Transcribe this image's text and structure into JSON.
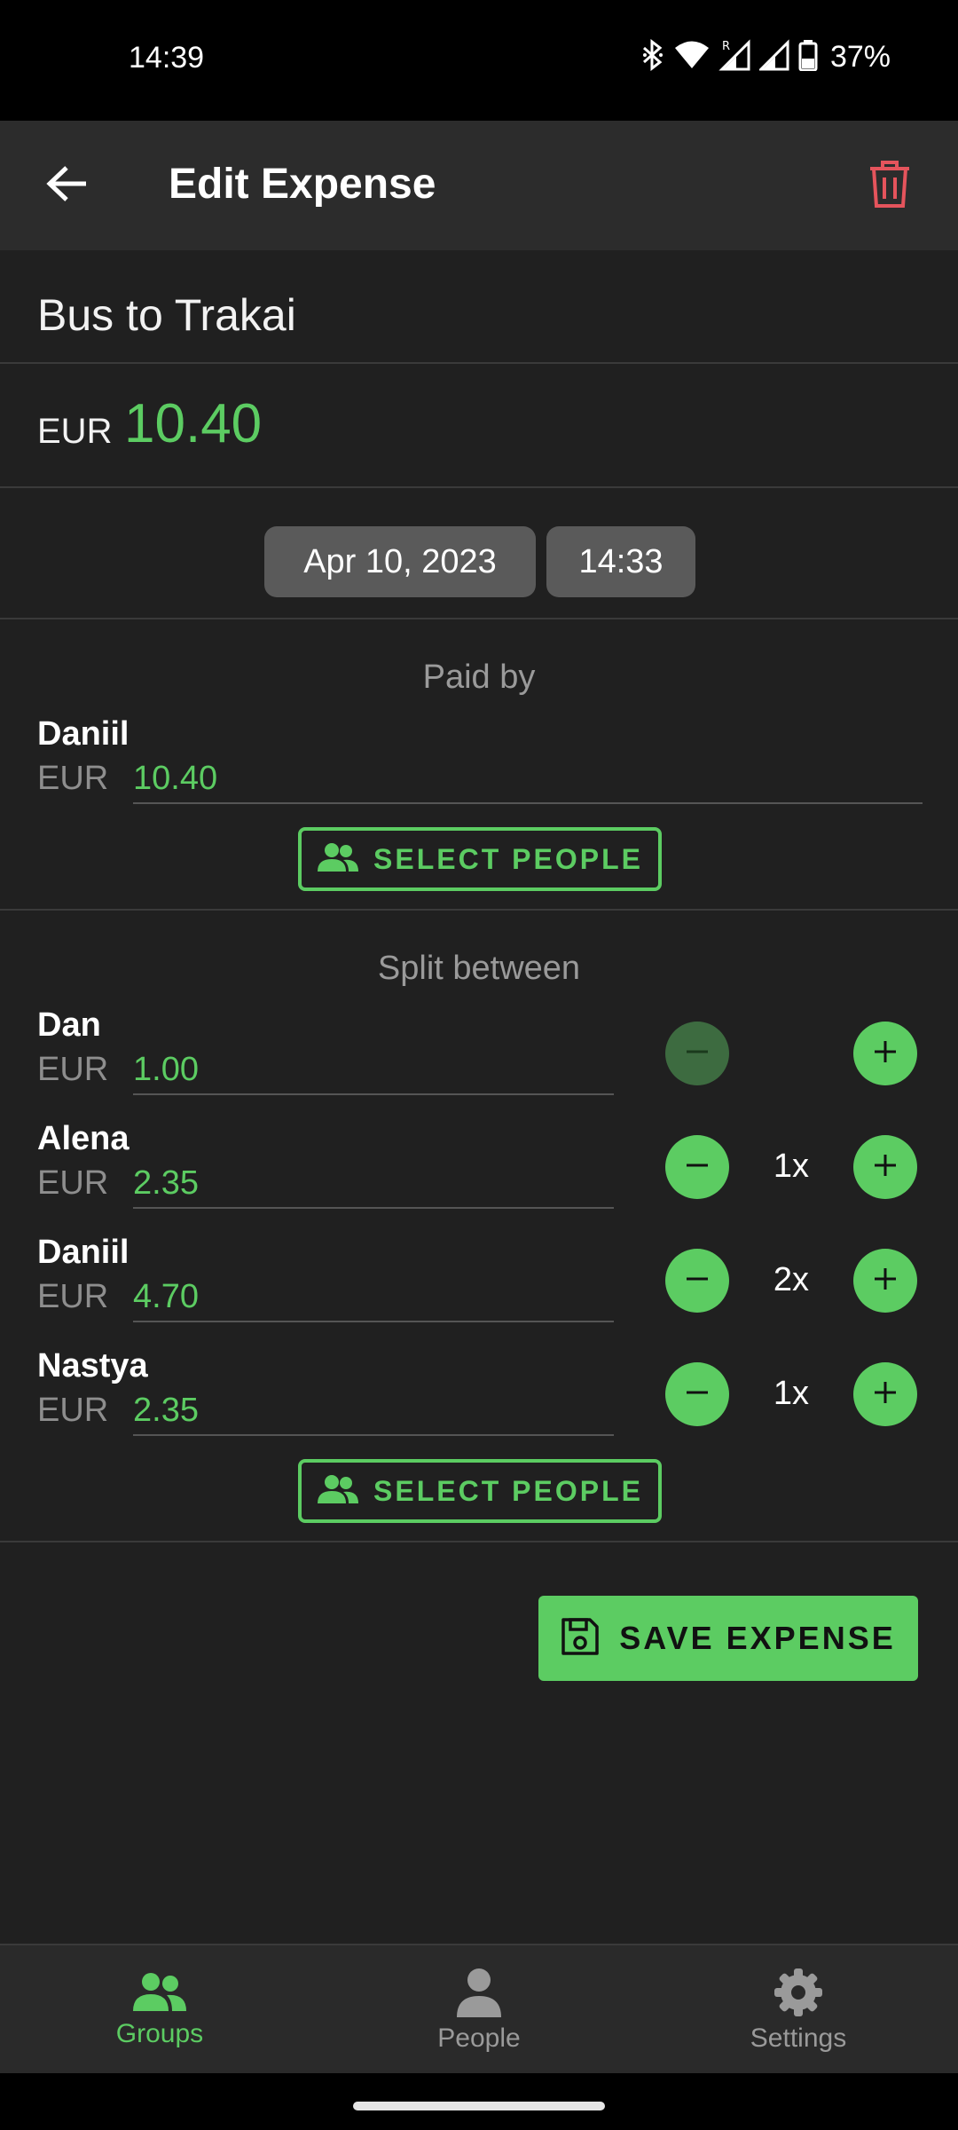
{
  "status_bar": {
    "time": "14:39",
    "battery": "37%"
  },
  "app_bar": {
    "title": "Edit Expense"
  },
  "expense": {
    "name": "Bus to Trakai",
    "currency": "EUR",
    "amount": "10.40",
    "date": "Apr 10, 2023",
    "time": "14:33"
  },
  "paid_by": {
    "title": "Paid by",
    "people": [
      {
        "name": "Daniil",
        "currency": "EUR",
        "amount": "10.40"
      }
    ],
    "select_label": "SELECT PEOPLE"
  },
  "split_between": {
    "title": "Split between",
    "people": [
      {
        "name": "Dan",
        "currency": "EUR",
        "amount": "1.00",
        "multiplier": ""
      },
      {
        "name": "Alena",
        "currency": "EUR",
        "amount": "2.35",
        "multiplier": "1x"
      },
      {
        "name": "Daniil",
        "currency": "EUR",
        "amount": "4.70",
        "multiplier": "2x"
      },
      {
        "name": "Nastya",
        "currency": "EUR",
        "amount": "2.35",
        "multiplier": "1x"
      }
    ],
    "select_label": "SELECT PEOPLE"
  },
  "save_label": "SAVE EXPENSE",
  "bottom_nav": {
    "items": [
      {
        "label": "Groups",
        "icon": "groups-icon",
        "active": true
      },
      {
        "label": "People",
        "icon": "person-icon",
        "active": false
      },
      {
        "label": "Settings",
        "icon": "gear-icon",
        "active": false
      }
    ]
  },
  "colors": {
    "accent": "#5ccc62",
    "delete": "#e5545c",
    "background": "#202020",
    "app_bar": "#2c2c2c",
    "inactive": "#9a9a9a"
  }
}
